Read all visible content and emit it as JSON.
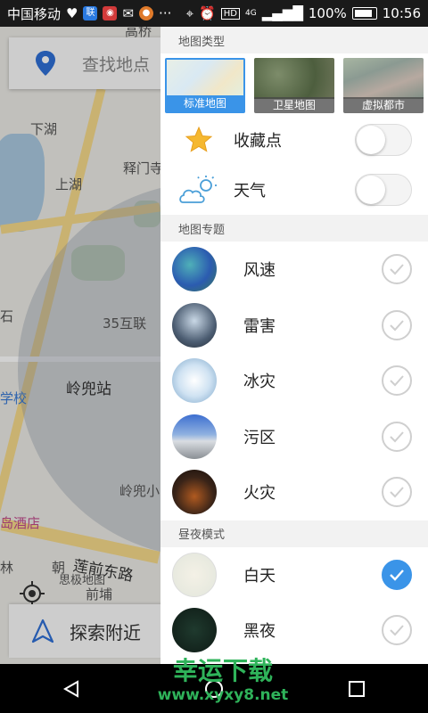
{
  "status_bar": {
    "carrier": "中国移动",
    "battery": "100%",
    "time": "10:56",
    "network": "4G"
  },
  "map": {
    "search_placeholder": "查找地点",
    "explore_label": "探索附近",
    "labels": [
      "高桥",
      "下湖",
      "释门寺",
      "上湖",
      "35互联",
      "岭兜站",
      "学校",
      "岭兜小",
      "岛酒店",
      "莲前东路",
      "思极地图",
      "前埔",
      "林",
      "朝",
      "石"
    ]
  },
  "drawer": {
    "map_type_header": "地图类型",
    "map_types": [
      {
        "label": "标准地图",
        "selected": true
      },
      {
        "label": "卫星地图",
        "selected": false
      },
      {
        "label": "虚拟都市",
        "selected": false
      }
    ],
    "toggles": [
      {
        "label": "收藏点",
        "icon": "star-icon",
        "on": false
      },
      {
        "label": "天气",
        "icon": "weather-icon",
        "on": false
      }
    ],
    "topic_header": "地图专题",
    "topics": [
      {
        "label": "风速",
        "checked": false
      },
      {
        "label": "雷害",
        "checked": false
      },
      {
        "label": "冰灾",
        "checked": false
      },
      {
        "label": "污区",
        "checked": false
      },
      {
        "label": "火灾",
        "checked": false
      }
    ],
    "daynight_header": "昼夜模式",
    "modes": [
      {
        "label": "白天",
        "checked": true
      },
      {
        "label": "黑夜",
        "checked": false
      }
    ]
  },
  "watermark": {
    "line1": "幸运下载",
    "line2": "www.xyxy8.net"
  },
  "colors": {
    "accent": "#3a94e8",
    "watermark": "#2fb35a"
  }
}
